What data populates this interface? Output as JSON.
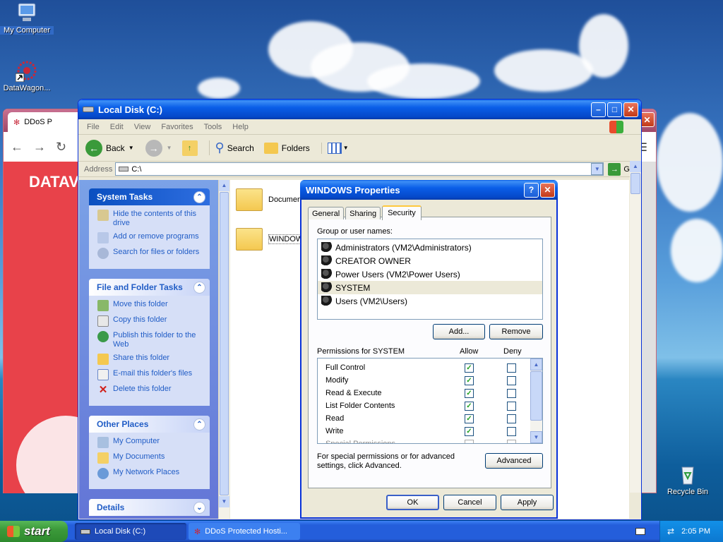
{
  "desktop": {
    "icons": [
      {
        "label": "My Computer"
      },
      {
        "label": "DataWagon..."
      },
      {
        "label": "Recycle Bin"
      }
    ]
  },
  "browser": {
    "tab_title": "DDoS P",
    "page_text": "DATAV"
  },
  "explorer": {
    "title": "Local Disk (C:)",
    "menu": [
      "File",
      "Edit",
      "View",
      "Favorites",
      "Tools",
      "Help"
    ],
    "toolbar": {
      "back": "Back",
      "search": "Search",
      "folders": "Folders"
    },
    "address_label": "Address",
    "address_value": "C:\\",
    "go": "Go",
    "system_tasks": {
      "title": "System Tasks",
      "items": [
        "Hide the contents of this drive",
        "Add or remove programs",
        "Search for files or folders"
      ]
    },
    "file_folder_tasks": {
      "title": "File and Folder Tasks",
      "items": [
        "Move this folder",
        "Copy this folder",
        "Publish this folder to the Web",
        "Share this folder",
        "E-mail this folder's files",
        "Delete this folder"
      ]
    },
    "other_places": {
      "title": "Other Places",
      "items": [
        "My Computer",
        "My Documents",
        "My Network Places"
      ]
    },
    "details": {
      "title": "Details"
    },
    "files": [
      {
        "name": "Documen"
      },
      {
        "name": "WINDOW"
      }
    ]
  },
  "dialog": {
    "title": "WINDOWS Properties",
    "tabs": [
      "General",
      "Sharing",
      "Security"
    ],
    "active_tab": "Security",
    "group_label": "Group or user names:",
    "users": [
      "Administrators (VM2\\Administrators)",
      "CREATOR OWNER",
      "Power Users (VM2\\Power Users)",
      "SYSTEM",
      "Users (VM2\\Users)"
    ],
    "selected_user": "SYSTEM",
    "add_button": "Add...",
    "remove_button": "Remove",
    "perm_label": "Permissions for SYSTEM",
    "allow_header": "Allow",
    "deny_header": "Deny",
    "permissions": [
      {
        "name": "Full Control",
        "allow": true,
        "deny": false
      },
      {
        "name": "Modify",
        "allow": true,
        "deny": false
      },
      {
        "name": "Read & Execute",
        "allow": true,
        "deny": false
      },
      {
        "name": "List Folder Contents",
        "allow": true,
        "deny": false
      },
      {
        "name": "Read",
        "allow": true,
        "deny": false
      },
      {
        "name": "Write",
        "allow": true,
        "deny": false
      },
      {
        "name": "Special Permissions",
        "allow": false,
        "deny": false
      }
    ],
    "advanced_note": "For special permissions or for advanced settings, click Advanced.",
    "advanced_button": "Advanced",
    "ok": "OK",
    "cancel": "Cancel",
    "apply": "Apply"
  },
  "taskbar": {
    "start": "start",
    "tasks": [
      "Local Disk (C:)",
      "DDoS Protected Hosti..."
    ],
    "clock": "2:05 PM"
  },
  "colors": {
    "accent": "#0a5ee8",
    "link": "#215dc6",
    "browser_red": "#e8424a",
    "taskbar": "#245edb",
    "start_green": "#3c9a3a"
  }
}
